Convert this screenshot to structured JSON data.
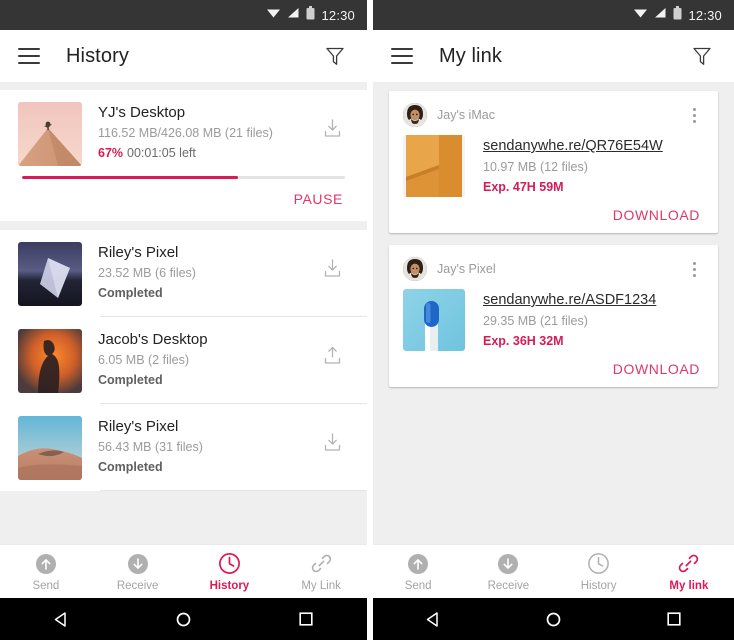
{
  "theme": {
    "accent": "#d81b56",
    "accent_light": "#e0376b",
    "statusbar_bg": "#353535",
    "page_bg": "#efeff0"
  },
  "status_bar": {
    "time": "12:30",
    "icons": [
      "wifi-icon",
      "signal-icon",
      "battery-icon"
    ]
  },
  "left_phone": {
    "appbar": {
      "menu_icon": "hamburger-icon",
      "title": "History",
      "filter_icon": "filter-icon"
    },
    "transfer_in_progress": {
      "title": "YJ's Desktop",
      "size": "116.52 MB/426.08 MB (21 files)",
      "percent": "67%",
      "time_left": "00:01:05 left",
      "progress_value": 67,
      "action_icon": "download-icon",
      "pause_label": "PAUSE",
      "thumbnail": "dune-sunset-pink"
    },
    "history_items": [
      {
        "title": "Riley's Pixel",
        "size": "23.52 MB (6 files)",
        "status": "Completed",
        "action_icon": "download-icon",
        "thumbnail": "night-blue-shape"
      },
      {
        "title": "Jacob's Desktop",
        "size": "6.05 MB (2 files)",
        "status": "Completed",
        "action_icon": "upload-icon",
        "thumbnail": "orange-silhouette"
      },
      {
        "title": "Riley's Pixel",
        "size": "56.43 MB (31 files)",
        "status": "Completed",
        "action_icon": "download-icon",
        "thumbnail": "dune-blue-sky"
      }
    ],
    "tabs": [
      {
        "label": "Send",
        "icon": "upload-circle-icon",
        "active": false
      },
      {
        "label": "Receive",
        "icon": "download-circle-icon",
        "active": false
      },
      {
        "label": "History",
        "icon": "clock-icon",
        "active": true
      },
      {
        "label": "My Link",
        "icon": "link-icon",
        "active": false
      }
    ]
  },
  "right_phone": {
    "appbar": {
      "menu_icon": "hamburger-icon",
      "title": "My link",
      "filter_icon": "filter-icon"
    },
    "link_cards": [
      {
        "owner": "Jay's iMac",
        "url": "sendanywhe.re/QR76E54W",
        "size": "10.97 MB (12 files)",
        "expires": "Exp. 47H 59M",
        "download_label": "DOWNLOAD",
        "menu_icon": "kebab-menu-icon",
        "thumbnail": "orange-folder"
      },
      {
        "owner": "Jay's Pixel",
        "url": "sendanywhe.re/ASDF1234",
        "size": "29.35 MB (21 files)",
        "expires": "Exp. 36H 32M",
        "download_label": "DOWNLOAD",
        "menu_icon": "kebab-menu-icon",
        "thumbnail": "blue-marker"
      }
    ],
    "tabs": [
      {
        "label": "Send",
        "icon": "upload-circle-icon",
        "active": false
      },
      {
        "label": "Receive",
        "icon": "download-circle-icon",
        "active": false
      },
      {
        "label": "History",
        "icon": "clock-icon",
        "active": false
      },
      {
        "label": "My link",
        "icon": "link-icon",
        "active": true
      }
    ]
  },
  "android_nav": {
    "back": "back-triangle-icon",
    "home": "home-circle-icon",
    "recents": "recents-square-icon"
  }
}
